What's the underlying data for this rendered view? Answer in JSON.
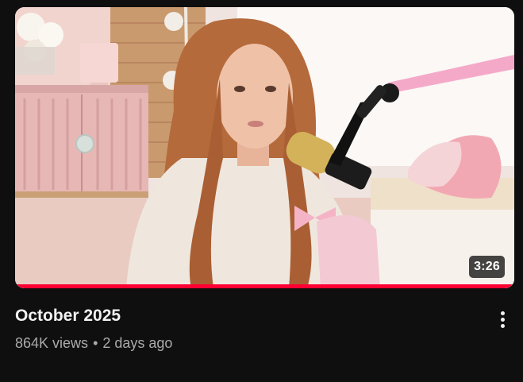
{
  "video": {
    "title": "October 2025",
    "views": "864K views",
    "separator": "•",
    "age": "2 days ago",
    "duration": "3:26",
    "watched_fraction": 1.0
  },
  "icons": {
    "more": "vertical-ellipsis-icon"
  },
  "colors": {
    "background": "#0f0f0f",
    "progress": "#ff0033",
    "title": "#f1f1f1",
    "meta": "#aaaaaa"
  }
}
